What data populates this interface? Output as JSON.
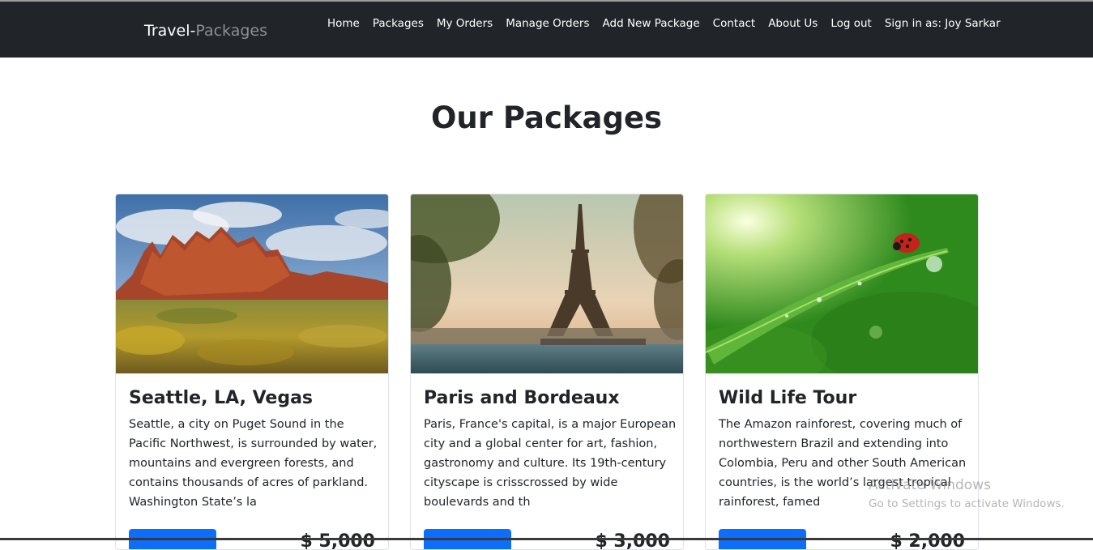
{
  "brand": {
    "part1": "Travel-",
    "part2": "Packages"
  },
  "nav": {
    "items": [
      {
        "label": "Home"
      },
      {
        "label": "Packages"
      },
      {
        "label": "My Orders"
      },
      {
        "label": "Manage Orders"
      },
      {
        "label": "Add New Package"
      },
      {
        "label": "Contact"
      },
      {
        "label": "About Us"
      },
      {
        "label": "Log out"
      },
      {
        "label": "Sign in as: Joy Sarkar"
      }
    ]
  },
  "main": {
    "title": "Our Packages"
  },
  "packages": [
    {
      "title": "Seattle, LA, Vegas",
      "description": "Seattle, a city on Puget Sound in the Pacific Northwest, is surrounded by water, mountains and evergreen forests, and contains thousands of acres of parkland. Washington State’s la",
      "price": "$ 5,000",
      "image": "desert-mountains-image"
    },
    {
      "title": "Paris and Bordeaux",
      "description": "Paris, France's capital, is a major European city and a global center for art, fashion, gastronomy and culture. Its 19th-century cityscape is crisscrossed by wide boulevards and th",
      "price": "$ 3,000",
      "image": "eiffel-tower-image"
    },
    {
      "title": "Wild Life Tour",
      "description": "The Amazon rainforest, covering much of northwestern Brazil and extending into Colombia, Peru and other South American countries, is the world’s largest tropical rainforest, famed",
      "price": "$ 2,000",
      "image": "ladybug-leaf-image"
    }
  ],
  "watermark": {
    "line1": "Activate Windows",
    "line2": "Go to Settings to activate Windows."
  },
  "colors": {
    "navbar": "#212529",
    "accent": "#0d6efd",
    "text": "#212529"
  }
}
